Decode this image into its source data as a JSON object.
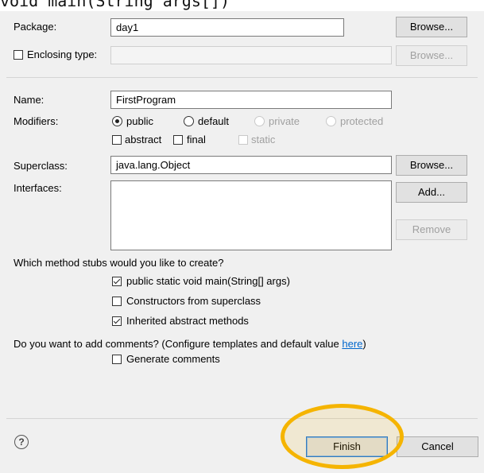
{
  "top_strip": {
    "code_text": "void main(String args[])"
  },
  "package": {
    "label": "Package:",
    "value": "day1",
    "browse_label": "Browse..."
  },
  "enclosing_type": {
    "label": "Enclosing type:",
    "value": "",
    "browse_label": "Browse...",
    "checked": false
  },
  "name": {
    "label": "Name:",
    "value": "FirstProgram"
  },
  "modifiers": {
    "label": "Modifiers:",
    "access": {
      "public": "public",
      "default": "default",
      "private": "private",
      "protected": "protected",
      "selected": "public"
    },
    "abstract": "abstract",
    "final": "final",
    "static": "static"
  },
  "superclass": {
    "label": "Superclass:",
    "value": "java.lang.Object",
    "browse_label": "Browse..."
  },
  "interfaces": {
    "label": "Interfaces:",
    "add_label": "Add...",
    "remove_label": "Remove"
  },
  "stubs": {
    "question": "Which method stubs would you like to create?",
    "main": "public static void main(String[] args)",
    "constructors": "Constructors from superclass",
    "inherited": "Inherited abstract methods",
    "main_checked": true,
    "constructors_checked": false,
    "inherited_checked": true
  },
  "comments": {
    "question_prefix": "Do you want to add comments? (Configure templates and default value ",
    "link": "here",
    "question_suffix": ")",
    "generate": "Generate comments",
    "checked": false
  },
  "footer": {
    "help_symbol": "?",
    "finish_label": "Finish",
    "cancel_label": "Cancel"
  },
  "colors": {
    "highlight": "#f5b400",
    "link": "#0066cc",
    "default_button_border": "#1a73d9"
  }
}
